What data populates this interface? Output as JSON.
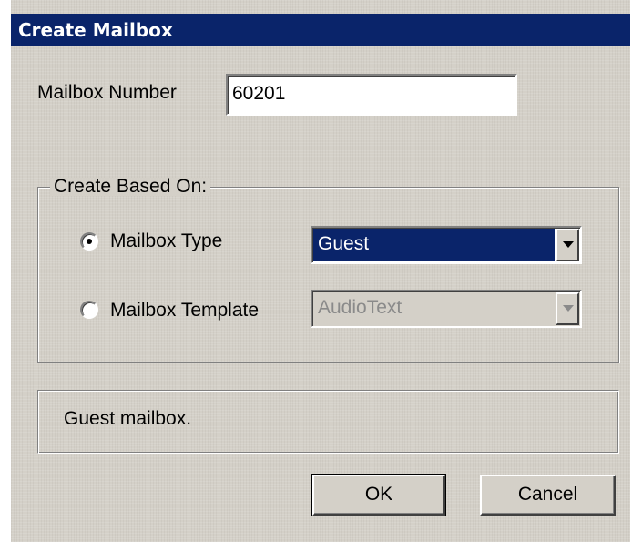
{
  "window": {
    "title": "Create Mailbox"
  },
  "mailbox_number": {
    "label": "Mailbox Number",
    "value": "60201"
  },
  "create_based_on": {
    "legend": "Create Based On:",
    "mailbox_type": {
      "label": "Mailbox Type",
      "selected": true,
      "value": "Guest",
      "enabled": true
    },
    "mailbox_template": {
      "label": "Mailbox Template",
      "selected": false,
      "value": "AudioText",
      "enabled": false
    }
  },
  "description": "Guest mailbox.",
  "buttons": {
    "ok": "OK",
    "cancel": "Cancel"
  },
  "colors": {
    "titlebar": "#0a246a",
    "dialog_face": "#d4d0c8",
    "selection": "#0a246a",
    "disabled_text": "#8a8a8a"
  },
  "icons": {
    "dropdown": "chevron-down-icon",
    "radio_selected": "radio-dot-icon"
  }
}
